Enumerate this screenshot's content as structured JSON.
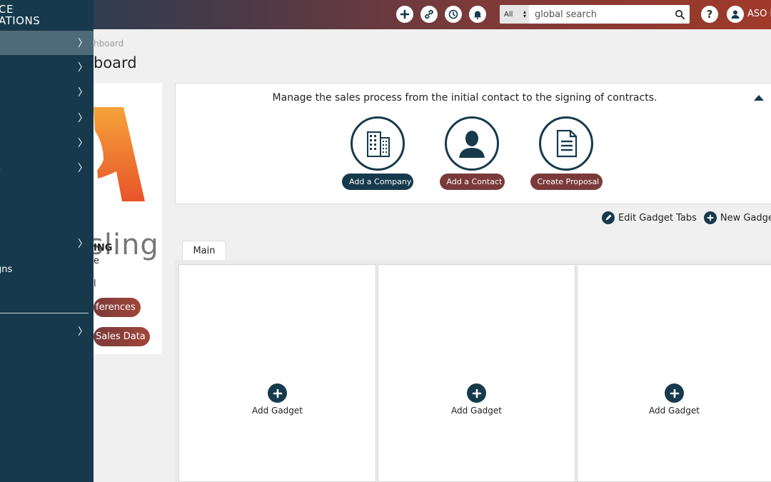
{
  "header": {
    "search_scope": "All",
    "search_placeholder": "global search",
    "help_label": "?",
    "user_name": "ASO M"
  },
  "sidebar": {
    "logo_line1": "CE",
    "logo_line2": "ATIONS",
    "items": [
      {
        "label": ""
      },
      {
        "label": "s"
      },
      {
        "label": ""
      },
      {
        "label": ""
      },
      {
        "label": ""
      },
      {
        "label": "s"
      },
      {
        "label": ""
      },
      {
        "label": ""
      },
      {
        "label": ""
      },
      {
        "label": "gns"
      },
      {
        "label": ""
      }
    ]
  },
  "breadcrumb": "hboard",
  "page_title": "board",
  "company": {
    "logo_text": "sling",
    "name": "ING",
    "line2": "e",
    "line3": "l",
    "prefs_label": "ferences",
    "sales_label": "Sales Data"
  },
  "banner": {
    "text": "Manage the sales process from the initial contact to the signing of contracts.",
    "actions": {
      "company": "Add a Company",
      "contact": "Add a Contact",
      "proposal": "Create Proposal"
    }
  },
  "gadget_tools": {
    "edit": "Edit Gadget Tabs",
    "new": "New Gadget Ta"
  },
  "tabs": {
    "main": "Main"
  },
  "gadgets": {
    "add_label": "Add Gadget"
  },
  "colors": {
    "sidebar": "#163a4c",
    "accent_red": "#7a3a3a",
    "navy": "#163a4c"
  }
}
